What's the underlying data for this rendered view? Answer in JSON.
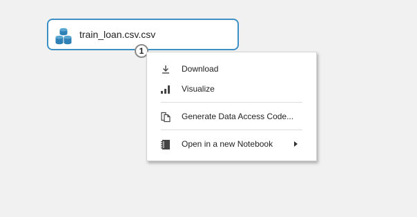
{
  "node": {
    "label": "train_loan.csv.csv",
    "icon": "dataset-icon",
    "port_number": "1",
    "border_color": "#3b8fc4"
  },
  "context_menu": {
    "items": [
      {
        "label": "Download",
        "icon": "download-icon"
      },
      {
        "label": "Visualize",
        "icon": "bar-chart-icon"
      },
      {
        "label": "Generate Data Access Code...",
        "icon": "copy-code-icon"
      },
      {
        "label": "Open in a new Notebook",
        "icon": "notebook-icon",
        "has_submenu": true
      }
    ]
  }
}
